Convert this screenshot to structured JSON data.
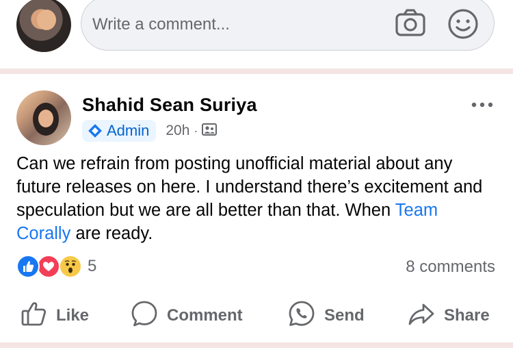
{
  "composer": {
    "placeholder": "Write a comment..."
  },
  "post": {
    "author": "Shahid Sean Suriya",
    "badge": "Admin",
    "time": "20h",
    "separator": "·",
    "text_parts": {
      "before_link": "Can we refrain from posting unofficial material about any future releases on here. I understand there’s excitement and speculation but we are all better than that. When ",
      "link": "Team Corally",
      "after_link": " are ready."
    },
    "reactions": {
      "types": [
        "like-icon",
        "love-icon",
        "wow-icon"
      ],
      "count": "5"
    },
    "comments_count": "8 comments"
  },
  "actions": {
    "like": "Like",
    "comment": "Comment",
    "send": "Send",
    "share": "Share"
  },
  "colors": {
    "accent": "#1877f2",
    "secondary_text": "#65676b",
    "divider": "#f4e4e4"
  }
}
